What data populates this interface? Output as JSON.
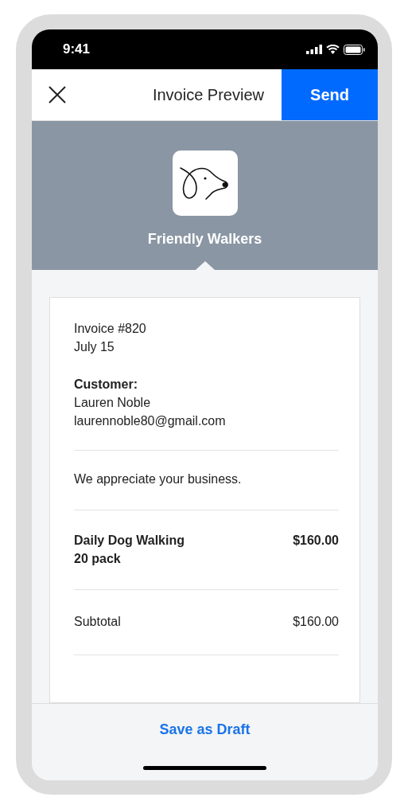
{
  "status_bar": {
    "time": "9:41"
  },
  "header": {
    "title": "Invoice Preview",
    "send_button": "Send"
  },
  "business": {
    "name": "Friendly Walkers"
  },
  "invoice": {
    "number": "Invoice #820",
    "date": "July 15",
    "customer_label": "Customer:",
    "customer_name": "Lauren Noble",
    "customer_email": "laurennoble80@gmail.com",
    "message": "We appreciate your business.",
    "line_items": [
      {
        "name": "Daily Dog Walking",
        "detail": "20 pack",
        "amount": "$160.00"
      }
    ],
    "subtotal": {
      "label": "Subtotal",
      "value": "$160.00"
    }
  },
  "footer": {
    "button": "Save as Draft"
  }
}
